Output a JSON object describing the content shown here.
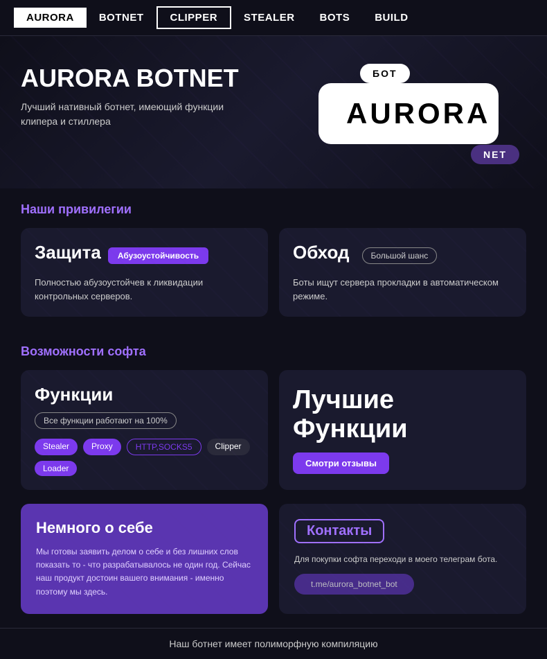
{
  "nav": {
    "items": [
      {
        "label": "AURORA",
        "style": "active-solid"
      },
      {
        "label": "BOTNET",
        "style": "normal"
      },
      {
        "label": "CLIPPER",
        "style": "active-outline"
      },
      {
        "label": "STEALER",
        "style": "normal"
      },
      {
        "label": "BOTS",
        "style": "normal"
      },
      {
        "label": "BUILD",
        "style": "normal"
      }
    ]
  },
  "hero": {
    "bot_badge": "БОТ",
    "aurora_text": "AURORA",
    "net_badge": "NET",
    "title": "AURORA BOTNET",
    "subtitle": "Лучший нативный ботнет, имеющий функции клипера и стиллера"
  },
  "privileges": {
    "section_title_plain": "Наши ",
    "section_title_accent": "привилегии",
    "card1": {
      "title": "Защита",
      "badge": "Абузоустойчивость",
      "text": "Полностью абузоустойчев к ликвидации контрольных серверов."
    },
    "card2": {
      "title": "Обход",
      "badge": "Большой шанс",
      "text": "Боты ищут сервера прокладки в автоматическом режиме."
    }
  },
  "features": {
    "section_title_plain": "Возможности ",
    "section_title_accent": "софта",
    "left_card": {
      "title": "Функции",
      "all_badge": "Все функции работают на 100%",
      "tags": [
        "Stealer",
        "Proxy",
        "HTTP,SOCKS5",
        "Clipper",
        "Loader"
      ]
    },
    "right_card": {
      "title_line1": "Лучшие",
      "title_line2": "Функции",
      "btn": "Смотри отзывы"
    }
  },
  "about": {
    "title": "Немного о себе",
    "text": "Мы готовы заявить делом о себе и без лишних слов показать то - что разрабатывалось не один год. Сейчас наш продукт достоин вашего внимания - именно поэтому мы здесь."
  },
  "contacts": {
    "title": "Контакты",
    "text": "Для покупки софта переходи в моего телеграм бота.",
    "btn": "t.me/aurora_botnet_bot"
  },
  "footer": {
    "text": "Наш ботнет имеет полиморфную компиляцию"
  }
}
